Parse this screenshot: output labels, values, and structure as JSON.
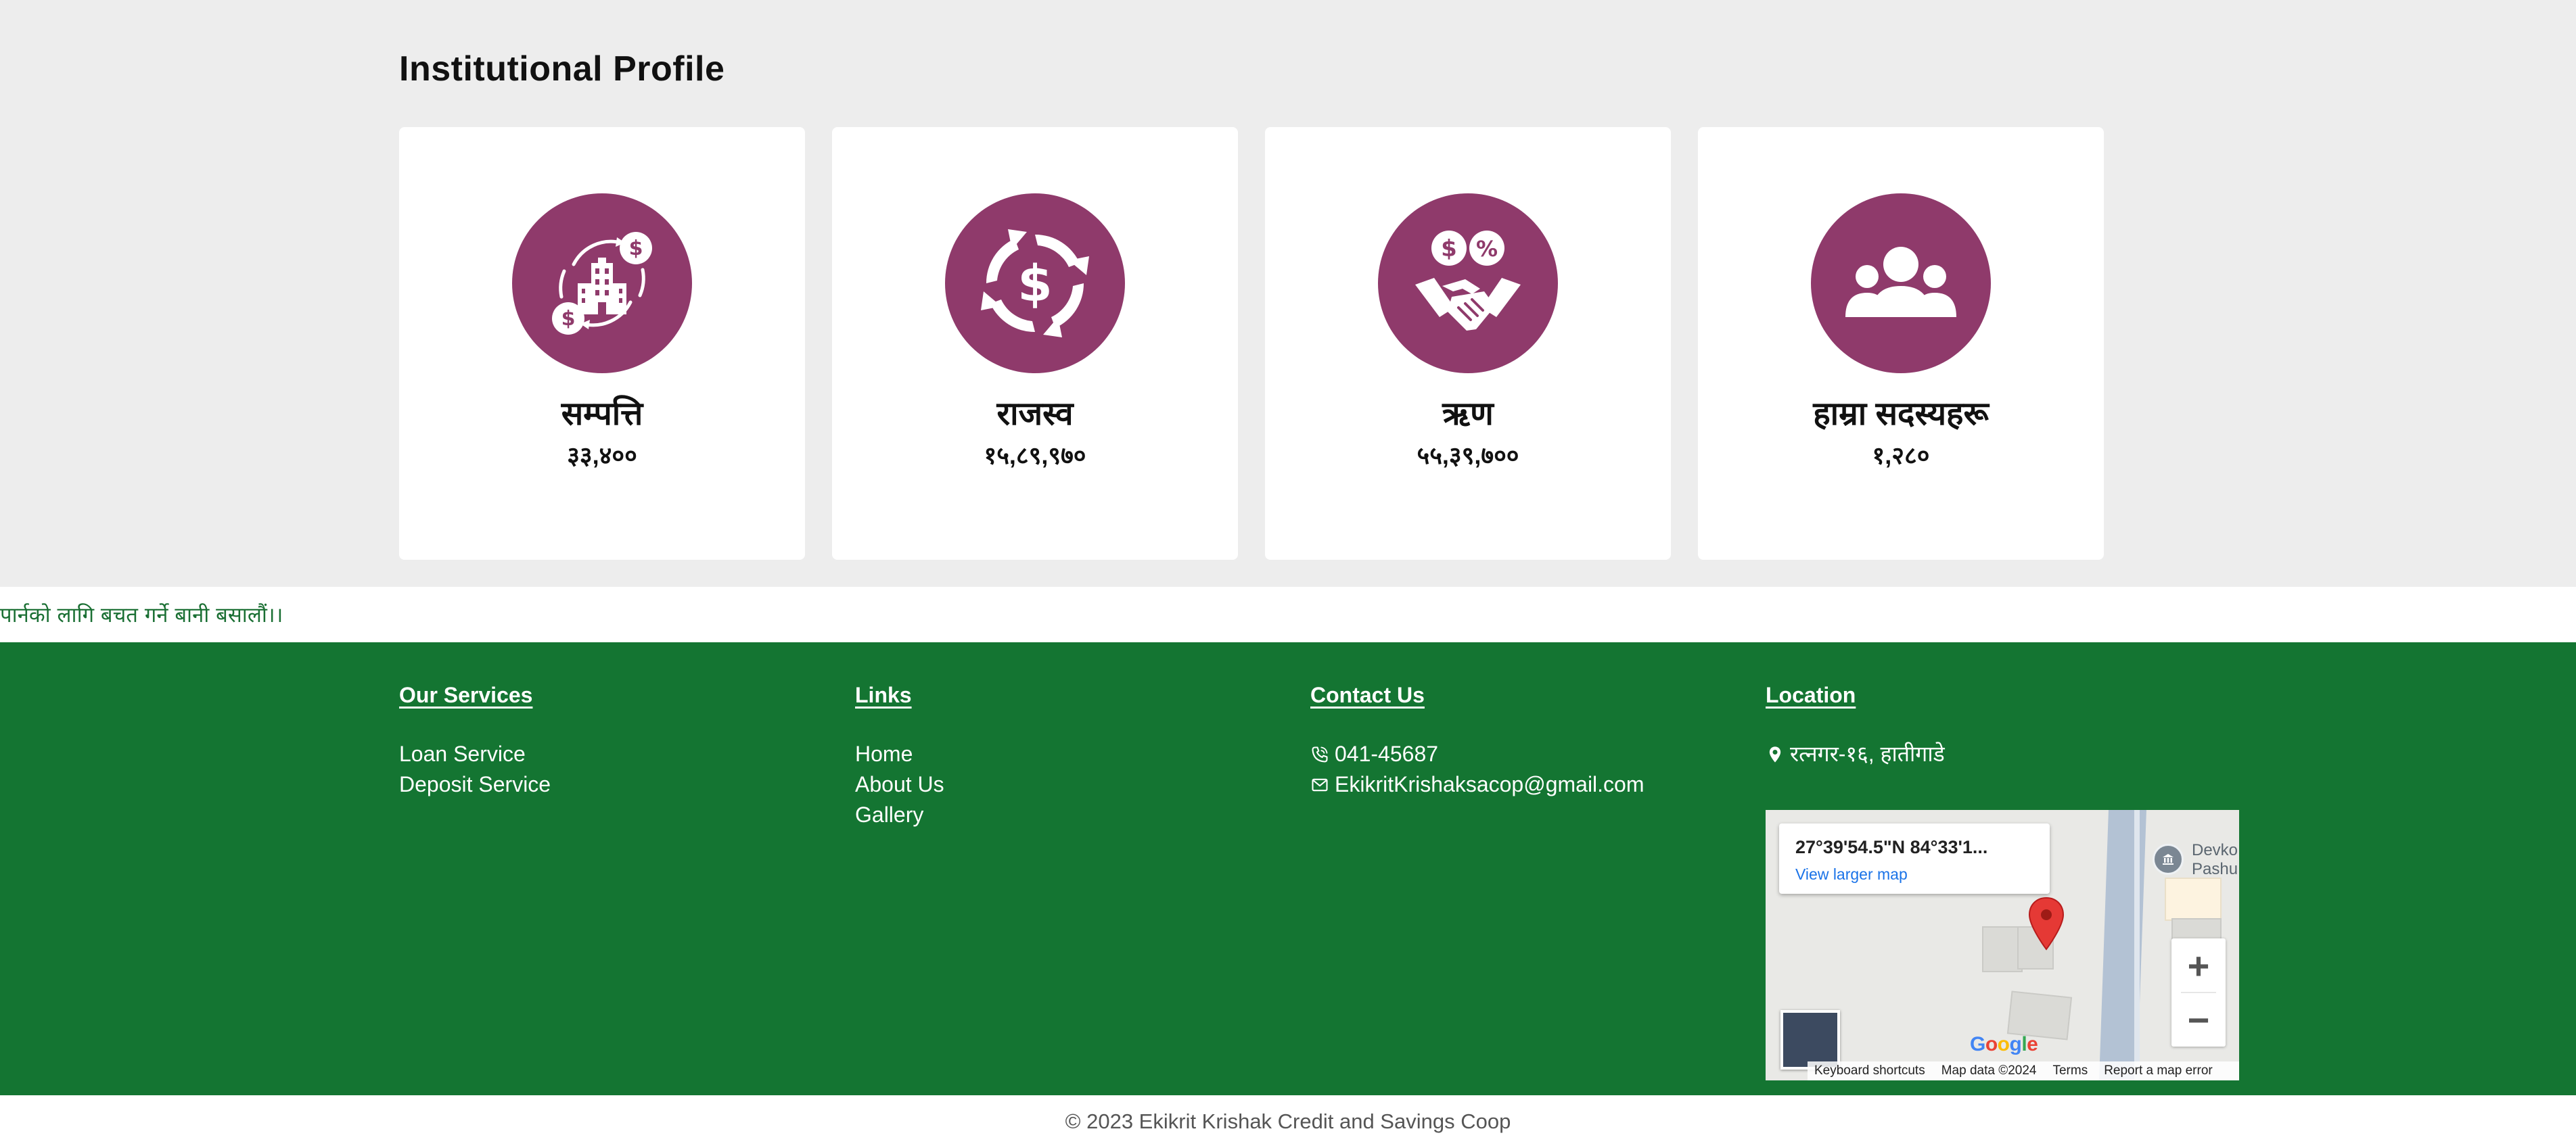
{
  "profile": {
    "title": "Institutional Profile",
    "accent_color": "#8f3a6b",
    "cards": [
      {
        "icon": "building-money-cycle-icon",
        "title": "सम्पत्ति",
        "value": "३३,४००"
      },
      {
        "icon": "dollar-cycle-icon",
        "title": "राजस्व",
        "value": "१५,८९,९७०"
      },
      {
        "icon": "handshake-loan-icon",
        "title": "ऋण",
        "value": "५५,३९,७००"
      },
      {
        "icon": "members-group-icon",
        "title": "हाम्रा सदस्यहरू",
        "value": "१,२८०"
      }
    ]
  },
  "ticker": {
    "text": "पार्नको लागि बचत गर्ने बानी बसालौं।।"
  },
  "footer": {
    "background_color": "#147532",
    "services": {
      "heading": "Our Services",
      "items": [
        "Loan Service",
        "Deposit Service"
      ]
    },
    "links": {
      "heading": "Links",
      "items": [
        "Home",
        "About Us",
        "Gallery"
      ]
    },
    "contact": {
      "heading": "Contact Us",
      "phone": "041-45687",
      "email": "EkikritKrishaksacop@gmail.com"
    },
    "location": {
      "heading": "Location",
      "address": "रत्नगर-१६, हातीगाडे",
      "map": {
        "coords": "27°39'54.5\"N 84°33'1...",
        "view_larger": "View larger map",
        "poi_line1": "Devko",
        "poi_line2": "Pashu",
        "zoom_in": "+",
        "zoom_out": "−",
        "google_logo": "Google",
        "keyboard_shortcuts": "Keyboard shortcuts",
        "map_data": "Map data ©2024",
        "terms": "Terms",
        "report": "Report a map error"
      }
    }
  },
  "copyright": "© 2023 Ekikrit Krishak Credit and Savings Coop"
}
